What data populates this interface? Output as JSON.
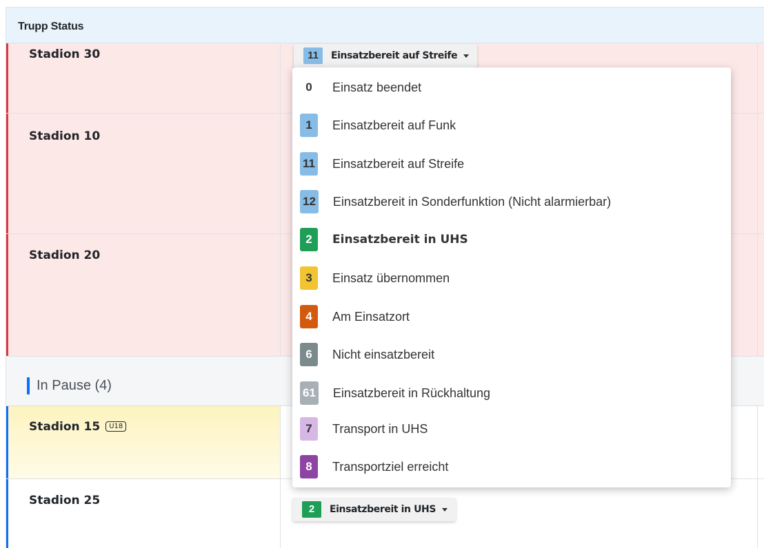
{
  "panel": {
    "title": "Trupp Status"
  },
  "rows": [
    {
      "name": "Stadion 30"
    },
    {
      "name": "Stadion 10"
    },
    {
      "name": "Stadion 20"
    },
    {
      "name": "Stadion 15",
      "badge": "U18"
    },
    {
      "name": "Stadion 25"
    }
  ],
  "pause_group": {
    "label": "In Pause (4)"
  },
  "status_buttons": {
    "top": {
      "num": "11",
      "label": "Einsatzbereit auf Streife"
    },
    "bottom": {
      "num": "2",
      "label": "Einsatzbereit in UHS"
    }
  },
  "dropdown": {
    "items": [
      {
        "num": "0",
        "label": "Einsatz beendet",
        "color": "#ffffff",
        "text_color": "#333333"
      },
      {
        "num": "1",
        "label": "Einsatzbereit auf Funk",
        "color": "#87bce6",
        "text_color": "#333333"
      },
      {
        "num": "11",
        "label": "Einsatzbereit auf Streife",
        "color": "#87bce6",
        "text_color": "#333333"
      },
      {
        "num": "12",
        "label": "Einsatzbereit in Sonderfunktion (Nicht alarmierbar)",
        "color": "#87bce6",
        "text_color": "#333333"
      },
      {
        "num": "2",
        "label": "Einsatzbereit in UHS",
        "color": "#1e9e57",
        "text_color": "#ffffff"
      },
      {
        "num": "3",
        "label": "Einsatz übernommen",
        "color": "#f2c431",
        "text_color": "#333333"
      },
      {
        "num": "4",
        "label": "Am Einsatzort",
        "color": "#d3590f",
        "text_color": "#ffffff"
      },
      {
        "num": "6",
        "label": "Nicht einsatzbereit",
        "color": "#7c8a8c",
        "text_color": "#ffffff"
      },
      {
        "num": "61",
        "label": "Einsatzbereit in Rückhaltung",
        "color": "#a8b0b6",
        "text_color": "#ffffff"
      },
      {
        "num": "7",
        "label": "Transport in UHS",
        "color": "#d7b7e4",
        "text_color": "#333333"
      },
      {
        "num": "8",
        "label": "Transportziel erreicht",
        "color": "#8e44a3",
        "text_color": "#ffffff"
      }
    ]
  },
  "colors": {
    "alert_red": "#dc3545",
    "pause_blue": "#0d6efd",
    "row_red_bg": "#fde8e8",
    "header_bg": "#e9f3fb"
  }
}
